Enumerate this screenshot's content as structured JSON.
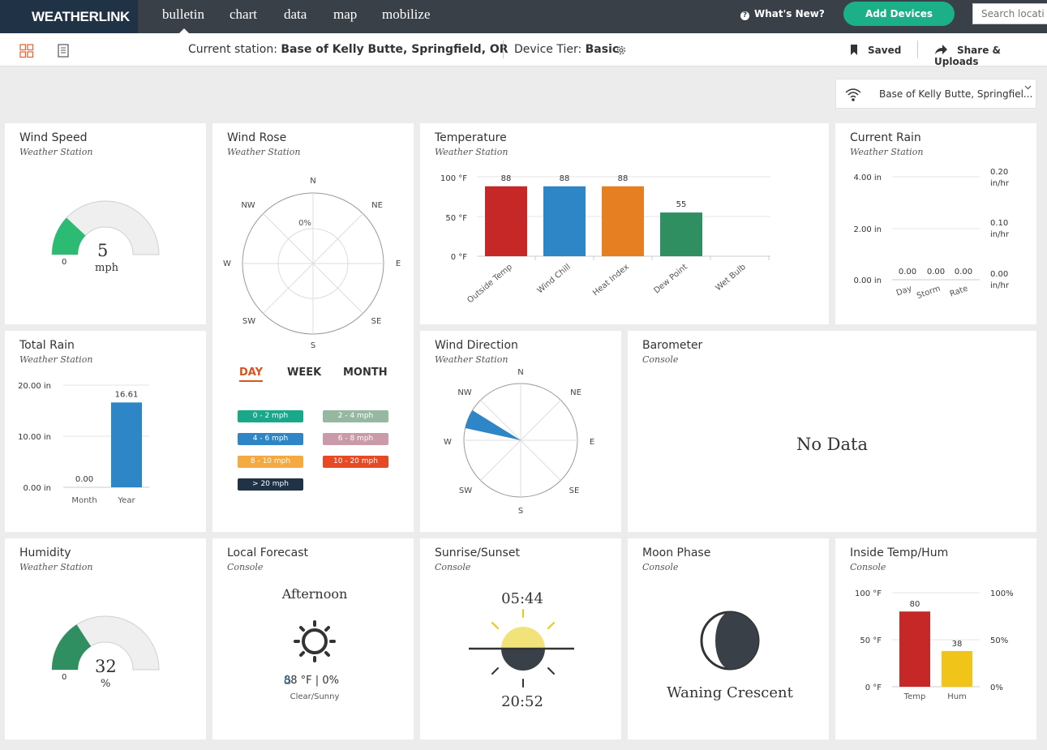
{
  "app": {
    "logo": "WEATHERLINK",
    "nav": [
      "bulletin",
      "chart",
      "data",
      "map",
      "mobilize"
    ],
    "whats_new": "What's New?",
    "add_devices": "Add Devices",
    "search_placeholder": "Search locatio"
  },
  "subbar": {
    "station_label": "Current station:",
    "station_name": "Base of Kelly Butte, Springfield, OR",
    "tier_label": "Device Tier:",
    "tier_value": "Basic",
    "saved": "Saved",
    "share": "Share & Uploads"
  },
  "station_select": "Base of Kelly Butte, Springfiel...",
  "wind_speed": {
    "title": "Wind Speed",
    "sub": "Weather Station",
    "value": "5",
    "unit": "mph",
    "min": "0"
  },
  "wind_rose": {
    "title": "Wind Rose",
    "sub": "Weather Station",
    "dirs": [
      "N",
      "NE",
      "E",
      "SE",
      "S",
      "SW",
      "W",
      "NW"
    ],
    "center": "0%",
    "tabs": [
      "DAY",
      "WEEK",
      "MONTH"
    ],
    "legend": [
      {
        "label": "0 - 2 mph",
        "color": "#1aa88a"
      },
      {
        "label": "2 - 4 mph",
        "color": "#96b8a2"
      },
      {
        "label": "4 - 6 mph",
        "color": "#2f86c6"
      },
      {
        "label": "6 - 8 mph",
        "color": "#c99aa8"
      },
      {
        "label": "8 - 10 mph",
        "color": "#f5a941"
      },
      {
        "label": "10 - 20 mph",
        "color": "#e64a24"
      },
      {
        "label": "> 20 mph",
        "color": "#1f3246"
      }
    ]
  },
  "temperature": {
    "title": "Temperature",
    "sub": "Weather Station",
    "yticks": [
      "100 °F",
      "50 °F",
      "0 °F"
    ],
    "categories": [
      "Outside Temp",
      "Wind Chill",
      "Heat Index",
      "Dew Point",
      "Wet Bulb"
    ],
    "values": [
      88,
      88,
      88,
      55,
      null
    ],
    "colors": [
      "#c62828",
      "#2f86c6",
      "#e67e22",
      "#2f8f60",
      "#999999"
    ]
  },
  "current_rain": {
    "title": "Current Rain",
    "sub": "Weather Station",
    "left_ticks": [
      "4.00 in",
      "2.00 in",
      "0.00 in"
    ],
    "right_ticks": [
      "0.20",
      "in/hr",
      "0.10",
      "in/hr",
      "0.00",
      "in/hr"
    ],
    "categories": [
      "Day",
      "Storm",
      "Rate"
    ],
    "values": [
      "0.00",
      "0.00",
      "0.00"
    ]
  },
  "total_rain": {
    "title": "Total Rain",
    "sub": "Weather Station",
    "yticks": [
      "20.00 in",
      "10.00 in",
      "0.00 in"
    ],
    "categories": [
      "Month",
      "Year"
    ],
    "values": [
      0.0,
      16.61
    ],
    "labels": [
      "0.00",
      "16.61"
    ]
  },
  "wind_direction": {
    "title": "Wind Direction",
    "sub": "Weather Station",
    "dirs": [
      "N",
      "NE",
      "E",
      "SE",
      "S",
      "SW",
      "W",
      "NW"
    ]
  },
  "barometer": {
    "title": "Barometer",
    "sub": "Console",
    "message": "No Data"
  },
  "humidity": {
    "title": "Humidity",
    "sub": "Weather Station",
    "value": "32",
    "unit": "%",
    "min": "0"
  },
  "forecast": {
    "title": "Local Forecast",
    "sub": "Console",
    "period": "Afternoon",
    "temp": "88 °F |",
    "precip": "0%",
    "condition": "Clear/Sunny"
  },
  "sun": {
    "title": "Sunrise/Sunset",
    "sub": "Console",
    "sunrise": "05:44",
    "sunset": "20:52"
  },
  "moon": {
    "title": "Moon Phase",
    "sub": "Console",
    "phase": "Waning Crescent"
  },
  "inside": {
    "title": "Inside Temp/Hum",
    "sub": "Console",
    "left_ticks": [
      "100 °F",
      "50 °F",
      "0 °F"
    ],
    "right_ticks": [
      "100%",
      "50%",
      "0%"
    ],
    "categories": [
      "Temp",
      "Hum"
    ],
    "values": [
      80,
      38
    ],
    "labels": [
      "80",
      "38"
    ],
    "colors": [
      "#c62828",
      "#f0c419"
    ]
  }
}
